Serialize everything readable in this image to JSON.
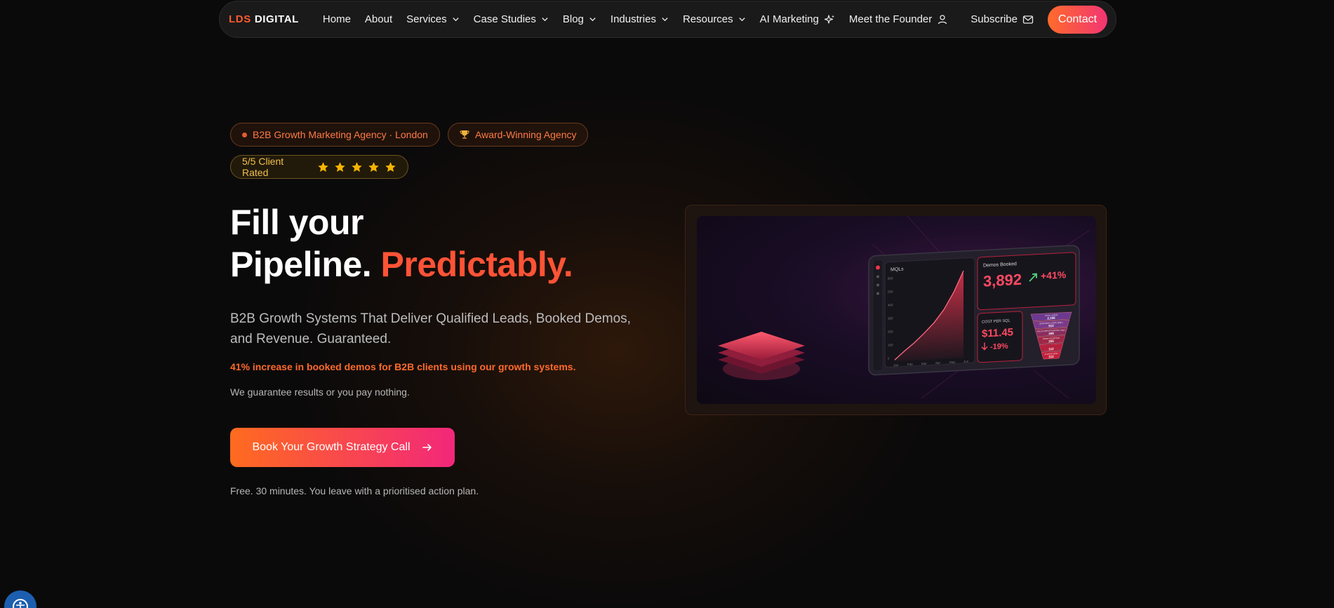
{
  "brand": {
    "part1": "LDS",
    "part2": "DIGITAL"
  },
  "nav": {
    "items": [
      {
        "label": "Home",
        "dropdown": false
      },
      {
        "label": "About",
        "dropdown": false
      },
      {
        "label": "Services",
        "dropdown": true
      },
      {
        "label": "Case Studies",
        "dropdown": true
      },
      {
        "label": "Blog",
        "dropdown": true
      },
      {
        "label": "Industries",
        "dropdown": true
      },
      {
        "label": "Resources",
        "dropdown": true
      }
    ],
    "ai_marketing": "AI Marketing",
    "founder": "Meet the Founder",
    "subscribe": "Subscribe",
    "contact": "Contact"
  },
  "badges": {
    "agency": "B2B Growth Marketing Agency · London",
    "award": "Award-Winning Agency",
    "rating": "5/5 Client Rated",
    "stars": 5
  },
  "hero": {
    "line1": "Fill your",
    "line2": "Pipeline.",
    "accent": "Predictably.",
    "subtitle": "B2B Growth Systems That Deliver Qualified Leads, Booked Demos, and Revenue. Guaranteed.",
    "stat": "41% increase in booked demos for B2B clients using our growth systems.",
    "guarantee": "We guarantee results or you pay nothing.",
    "cta": "Book Your Growth Strategy Call",
    "note": "Free. 30 minutes. You leave with a prioritised action plan."
  },
  "dashboard": {
    "chart_label": "MQLs",
    "yticks": [
      "600",
      "500",
      "400",
      "300",
      "200",
      "100",
      "0"
    ],
    "months": [
      "Jan",
      "Feb",
      "Mar",
      "Apr",
      "May",
      "Jun"
    ],
    "demos_label": "Demos Booked",
    "demos_value": "3,892",
    "demos_change": "+41%",
    "cps_label": "COST PER SQL",
    "cps_value": "$11.45",
    "cps_change": "-19%",
    "funnel": [
      {
        "label": "TOTAL LEADS",
        "value": "2,195"
      },
      {
        "label": "QUALIFIED LEADS (MQL)",
        "value": "912"
      },
      {
        "label": "SALES OPPORTUNITIES (SQL)",
        "value": "408"
      },
      {
        "label": "DEMO ACCEPTED",
        "value": "255"
      },
      {
        "label": "",
        "value": "112"
      },
      {
        "label": "CLOSED WON",
        "value": "112"
      }
    ]
  },
  "colors": {
    "accent": "#ff5336",
    "brand_orange": "#ff6b2b",
    "brand_pink": "#f23573",
    "star": "#f5b400"
  }
}
